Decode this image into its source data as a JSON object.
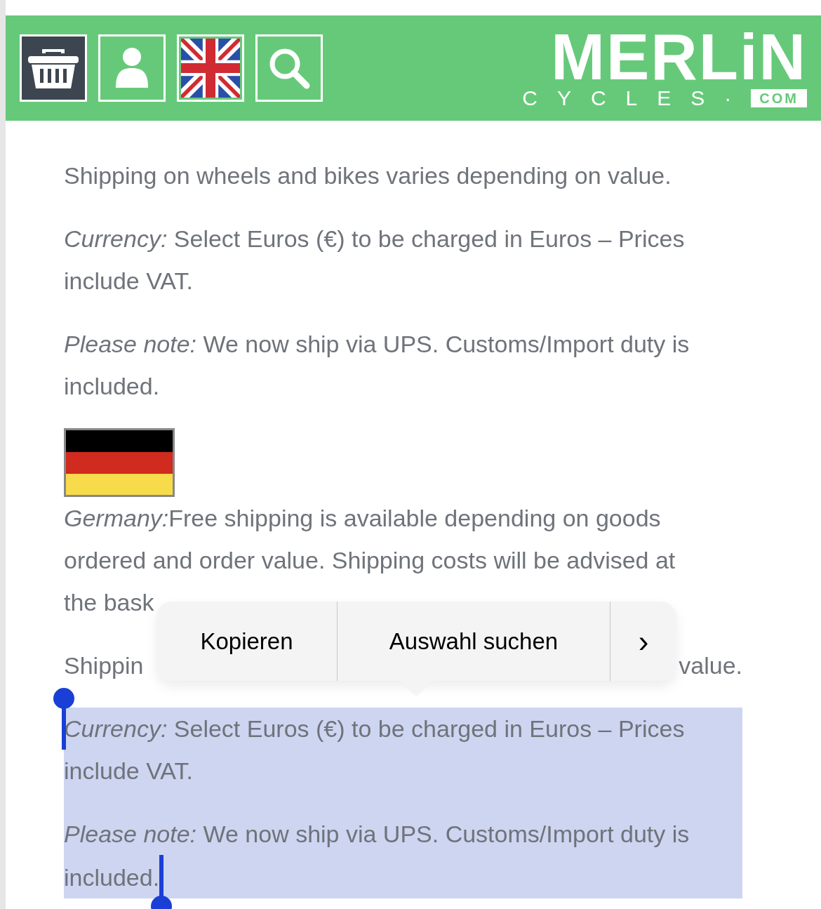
{
  "header": {
    "buttons": [
      {
        "kind": "basket",
        "selected": true
      },
      {
        "kind": "account",
        "selected": false
      },
      {
        "kind": "language",
        "selected": false
      },
      {
        "kind": "search",
        "selected": false
      }
    ],
    "logo": {
      "name": "MERLiN",
      "tagline": "CYCLES·",
      "domain": "COM"
    }
  },
  "content": [
    {
      "kind": "text",
      "text": "Shipping on wheels and bikes varies depending on value.",
      "selected": false
    },
    {
      "kind": "text",
      "label": "Currency:",
      "text": " Select Euros (€) to be charged in Euros – Prices include VAT.",
      "selected": false
    },
    {
      "kind": "text",
      "label": "Please note:",
      "text": " We now ship via UPS. Customs/Import duty is included.",
      "selected": false
    },
    {
      "kind": "flag"
    },
    {
      "kind": "text",
      "label": "Germany:",
      "text": "Free shipping is available depending on goods ordered and order value. Shipping costs will be advised at",
      "selected": false
    },
    {
      "kind": "split",
      "parts": [
        "the bask"
      ],
      "selected": false
    },
    {
      "kind": "split",
      "parts": [
        "Shippin",
        "value."
      ],
      "selected": false
    },
    {
      "kind": "text",
      "label": "Currency:",
      "text": " Select Euros (€) to be charged in Euros – Prices include VAT.",
      "selected": true
    },
    {
      "kind": "text",
      "label": "Please note:",
      "text": " We now ship via UPS. Customs/Import duty is included.",
      "selected": true
    }
  ],
  "context_menu": {
    "items": [
      "Kopieren",
      "Auswahl suchen"
    ],
    "more": "›"
  }
}
